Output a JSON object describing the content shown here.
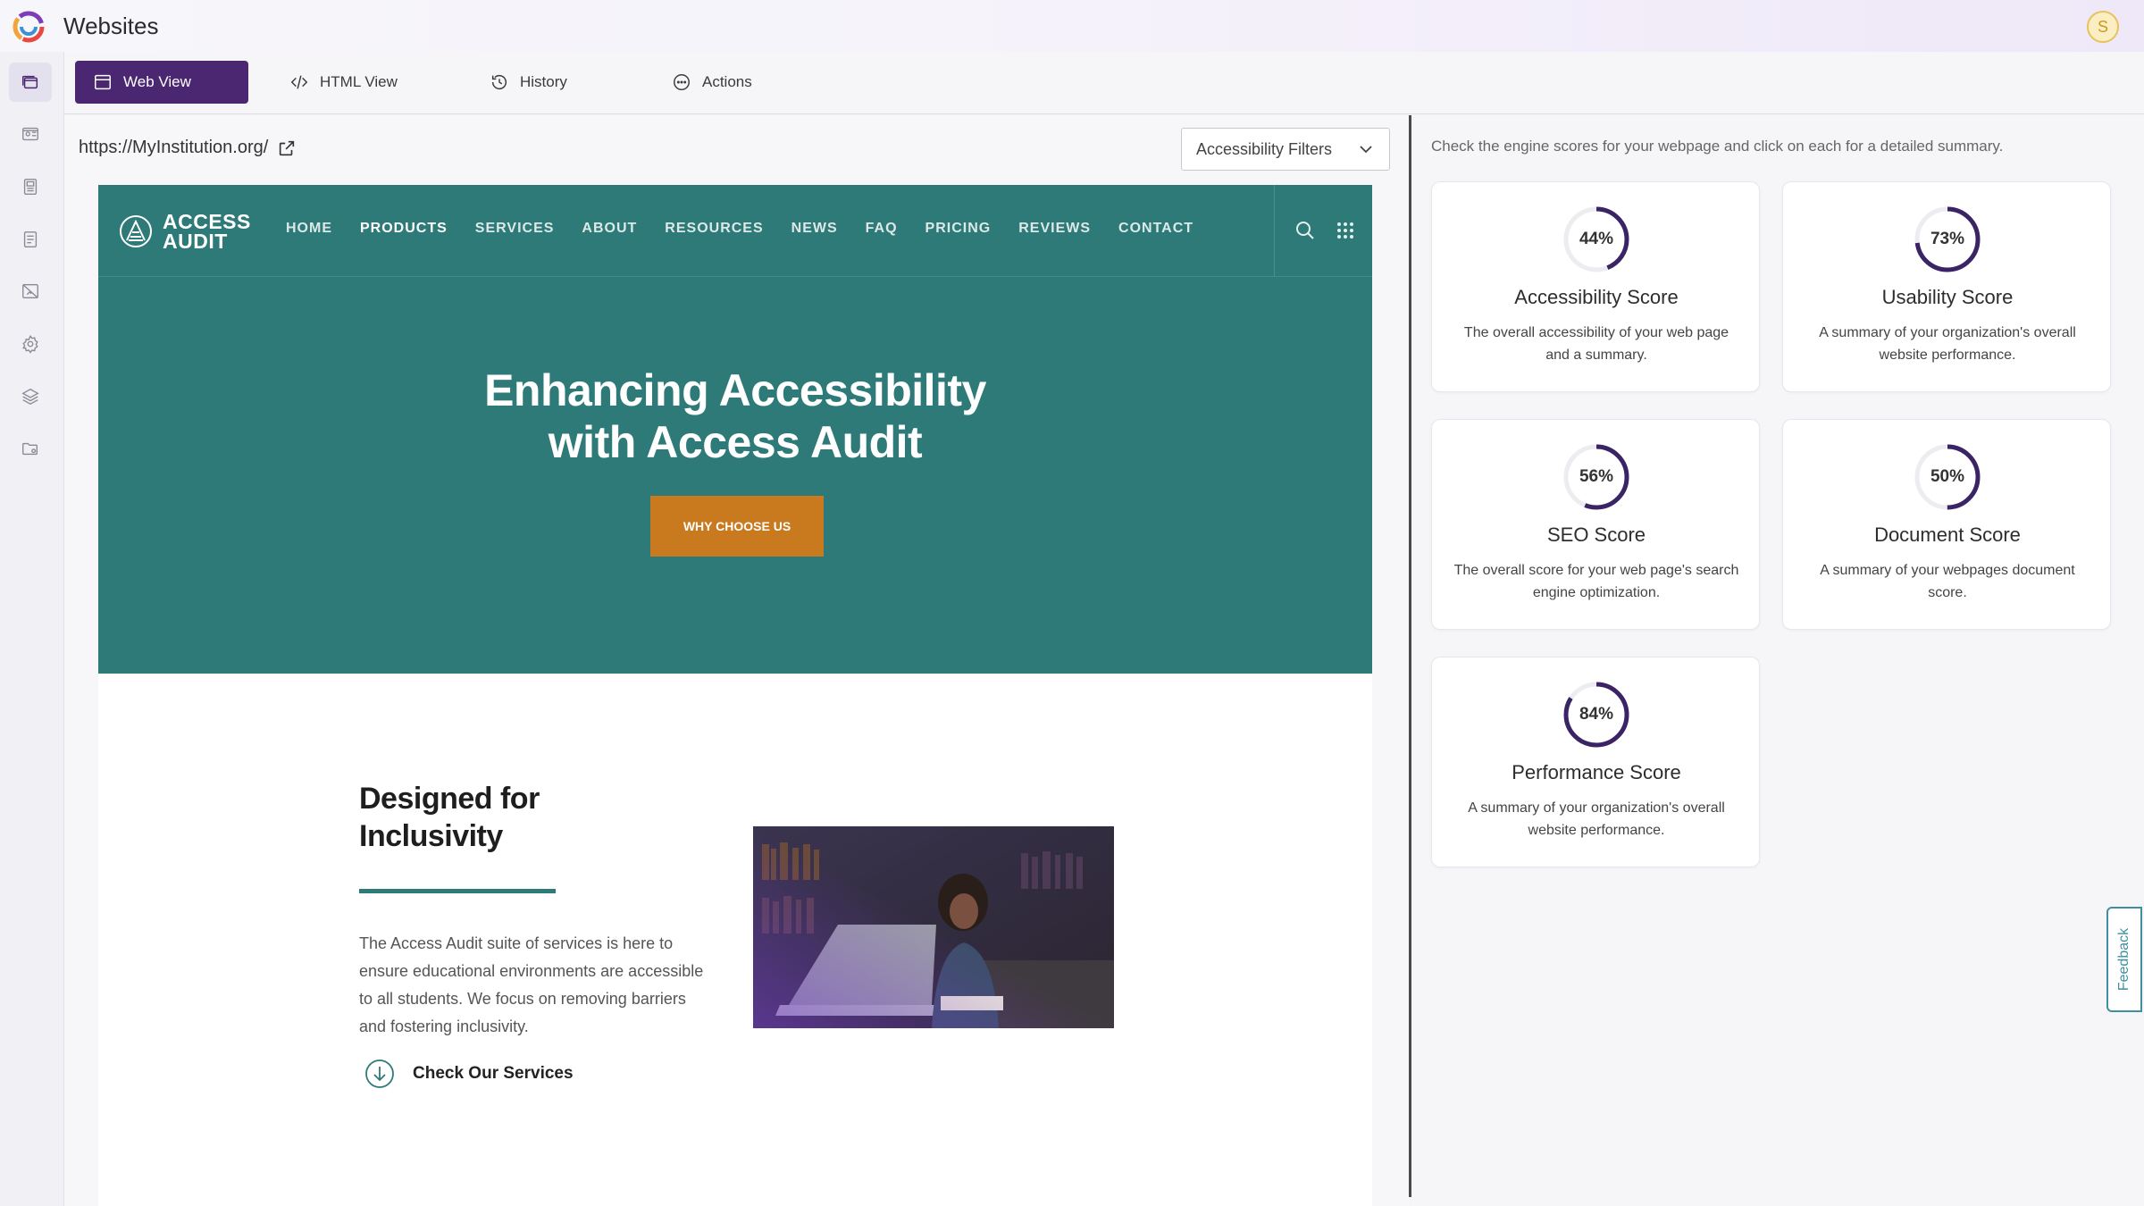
{
  "app": {
    "title": "Websites",
    "user_initial": "S"
  },
  "sidebar": {
    "items": [
      {
        "icon": "websites-icon",
        "active": true
      },
      {
        "icon": "id-card-icon",
        "active": false
      },
      {
        "icon": "newspaper-icon",
        "active": false
      },
      {
        "icon": "document-icon",
        "active": false
      },
      {
        "icon": "image-off-icon",
        "active": false
      },
      {
        "icon": "gear-icon",
        "active": false
      },
      {
        "icon": "layers-icon",
        "active": false
      },
      {
        "icon": "folder-settings-icon",
        "active": false
      }
    ]
  },
  "tabs": [
    {
      "label": "Web View",
      "icon": "browser-window-icon",
      "active": true
    },
    {
      "label": "HTML View",
      "icon": "code-icon",
      "active": false
    },
    {
      "label": "History",
      "icon": "history-icon",
      "active": false
    },
    {
      "label": "Actions",
      "icon": "more-circle-icon",
      "active": false
    }
  ],
  "viewer": {
    "url": "https://MyInstitution.org/",
    "filters_label": "Accessibility Filters"
  },
  "site": {
    "logo_line1": "ACCESS",
    "logo_line2": "AUDIT",
    "nav": [
      "HOME",
      "PRODUCTS",
      "SERVICES",
      "ABOUT",
      "RESOURCES",
      "NEWS",
      "FAQ",
      "PRICING",
      "REVIEWS",
      "CONTACT"
    ],
    "nav_current": "PRODUCTS",
    "hero_line1": "Enhancing Accessibility",
    "hero_line2": "with Access Audit",
    "hero_button": "WHY CHOOSE US",
    "section_title_line1": "Designed for",
    "section_title_line2": "Inclusivity",
    "section_body": "The Access Audit suite of services is here to ensure educational environments are accessible to all students. We focus on removing barriers and fostering inclusivity.",
    "section_link": "Check Our Services",
    "colors": {
      "brand_teal": "#2d7a78",
      "cta_orange": "#c97a1e"
    }
  },
  "scores": {
    "intro": "Check the engine scores for your webpage and click on each for a detailed summary.",
    "ring_color": "#3b2466",
    "cards": [
      {
        "percent": 44,
        "label": "44%",
        "title": "Accessibility Score",
        "desc": "The overall accessibility of your web page and a summary."
      },
      {
        "percent": 73,
        "label": "73%",
        "title": "Usability Score",
        "desc": "A summary of your organization's overall website performance."
      },
      {
        "percent": 56,
        "label": "56%",
        "title": "SEO Score",
        "desc": "The overall score for your web page's search engine optimization."
      },
      {
        "percent": 50,
        "label": "50%",
        "title": "Document Score",
        "desc": "A summary of your webpages document score."
      },
      {
        "percent": 84,
        "label": "84%",
        "title": "Performance Score",
        "desc": "A summary of your organization's overall website performance."
      }
    ]
  },
  "feedback_label": "Feedback",
  "colors": {
    "accent_purple": "#4a2770"
  }
}
